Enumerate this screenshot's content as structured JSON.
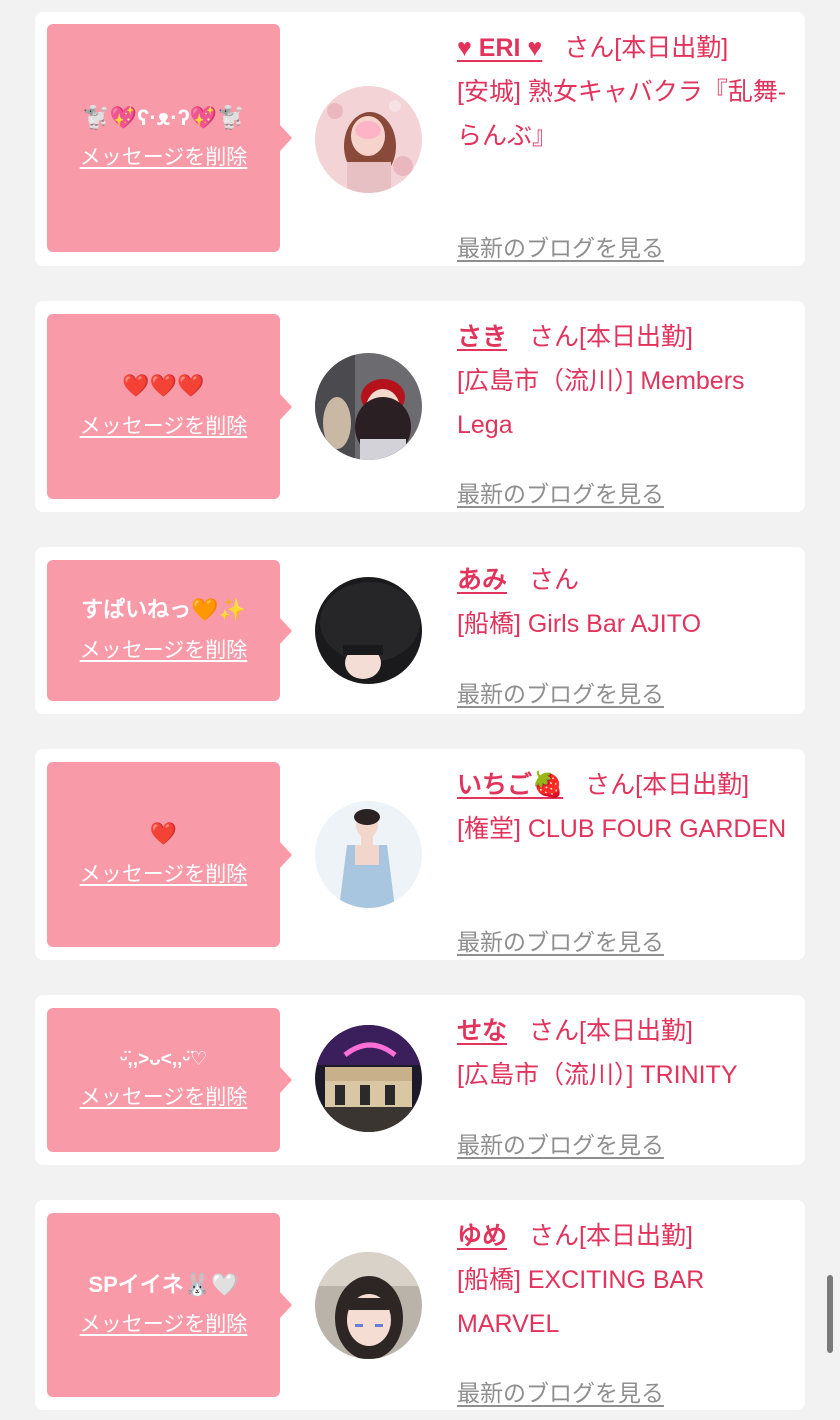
{
  "delete_label": "メッセージを削除",
  "blog_label": "最新のブログを見る",
  "san_label": "さん",
  "colors": {
    "accent": "#e2335c",
    "bubble": "#f99aa8",
    "link_gray": "#8f8f8f",
    "background": "#f2f2f2"
  },
  "cards": [
    {
      "message": "🐩💖ʕ·ᴥ·ʔ💖🐩",
      "name": "♥ ERI ♥",
      "status": "[本日出勤]",
      "shop_line1": "[安城] 熟女キャバクラ『乱舞-らんぶ』",
      "shop_line2": ""
    },
    {
      "message": "❤️❤️❤️",
      "name": "さき",
      "status": "[本日出勤]",
      "shop_line1": "[広島市（流川）] Members Lega",
      "shop_line2": ""
    },
    {
      "message": "すぱいねっ🧡✨",
      "name": "あみ",
      "status": "",
      "shop_line1": "[船橋] Girls Bar AJITO",
      "shop_line2": ""
    },
    {
      "message": "❤️",
      "name": "いちご🍓",
      "status": "[本日出勤]",
      "shop_line1": "[権堂] CLUB FOUR GARDEN",
      "shop_line2": ""
    },
    {
      "message": "ᵕ̈,,>ᴗ<,,ᵕ̈♡",
      "name": "せな",
      "status": "[本日出勤]",
      "shop_line1": "[広島市（流川）] TRINITY",
      "shop_line2": ""
    },
    {
      "message": "SPイイネ🐰🤍",
      "name": "ゆめ",
      "status": "[本日出勤]",
      "shop_line1": "[船橋] EXCITING BAR MARVEL",
      "shop_line2": ""
    }
  ]
}
